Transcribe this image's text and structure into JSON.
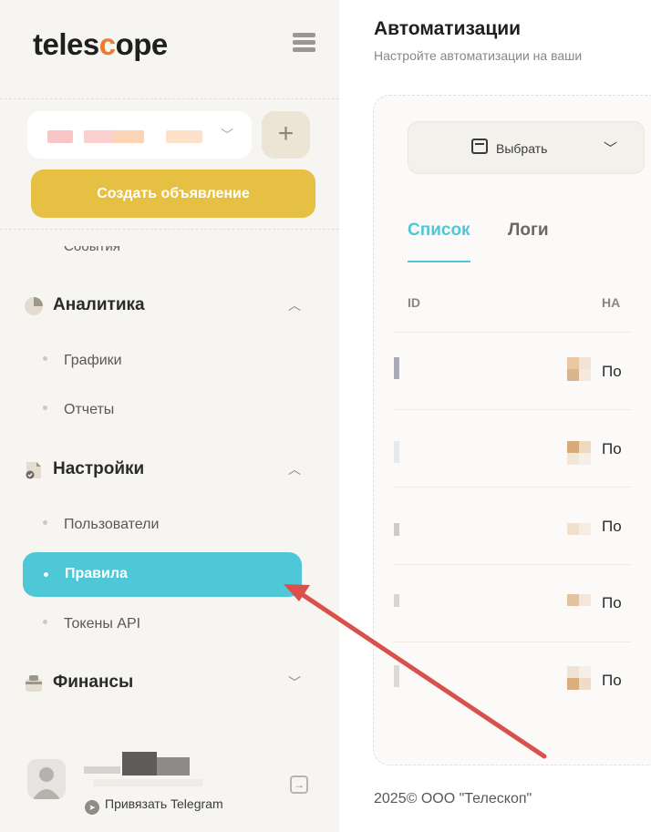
{
  "sidebar": {
    "logo_text_start": "teles",
    "logo_text_accent": "c",
    "logo_text_end": "ope",
    "create_button": "Создать объявление",
    "add_button": "+",
    "clipped_item": "События",
    "sections": [
      {
        "label": "Аналитика",
        "icon": "pie-chart-icon",
        "items": [
          "Графики",
          "Отчеты"
        ]
      },
      {
        "label": "Настройки",
        "icon": "settings-doc-icon",
        "items": [
          "Пользователи",
          "Правила",
          "Токены API"
        ]
      },
      {
        "label": "Финансы",
        "icon": "wallet-icon",
        "items": []
      }
    ],
    "active_item": "Правила",
    "telegram_link": "Привязать Telegram"
  },
  "main": {
    "title": "Автоматизации",
    "subtitle": "Настройте автоматизации на ваши",
    "period_label": "Выбрать",
    "tabs": [
      "Список",
      "Логи"
    ],
    "active_tab": "Список",
    "columns": [
      "ID",
      "НА"
    ],
    "rows": [
      {
        "name": "По"
      },
      {
        "name": "По"
      },
      {
        "name": "По"
      },
      {
        "name": "По"
      },
      {
        "name": "По"
      }
    ]
  },
  "footer": {
    "copyright": "2025© ООО \"Телескоп\""
  },
  "colors": {
    "accent": "#4ec7d7",
    "create_button": "#e6c042",
    "annotation_arrow": "#d9514a"
  }
}
